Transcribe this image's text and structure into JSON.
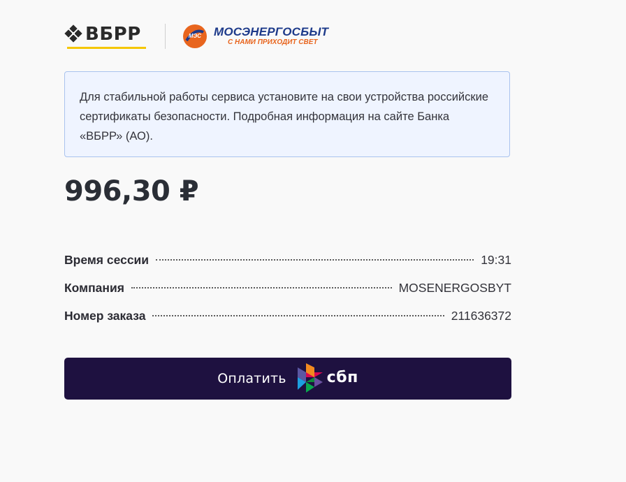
{
  "header": {
    "bank_logo_text": "ВБРР",
    "partner_name": "МОСЭНЕРГОСБЫТ",
    "partner_slogan": "С НАМИ ПРИХОДИТ СВЕТ",
    "partner_badge": "МЭС"
  },
  "notice": {
    "text": "Для стабильной работы сервиса установите на свои устройства российские сертификаты безопасности. Подробная информация на сайте Банка «ВБРР» (АО)."
  },
  "payment": {
    "amount": "996,30 ₽"
  },
  "details": [
    {
      "label": "Время сессии",
      "value": "19:31"
    },
    {
      "label": "Компания",
      "value": "MOSENERGOSBYT"
    },
    {
      "label": "Номер заказа",
      "value": "211636372"
    }
  ],
  "pay_button": {
    "label": "Оплатить",
    "brand": "сбп"
  },
  "colors": {
    "background": "#f9f9f9",
    "notice_bg": "#eff4ff",
    "notice_border": "#a9c3ee",
    "button_bg": "#1e1140",
    "bank_accent": "#f5c600",
    "partner_blue": "#1d3a8a",
    "partner_orange": "#e8651e"
  },
  "icons": {
    "bank_logo": "vbrr-logo-icon",
    "partner_logo": "mes-logo-icon",
    "sbp_logo": "sbp-logo-icon"
  }
}
